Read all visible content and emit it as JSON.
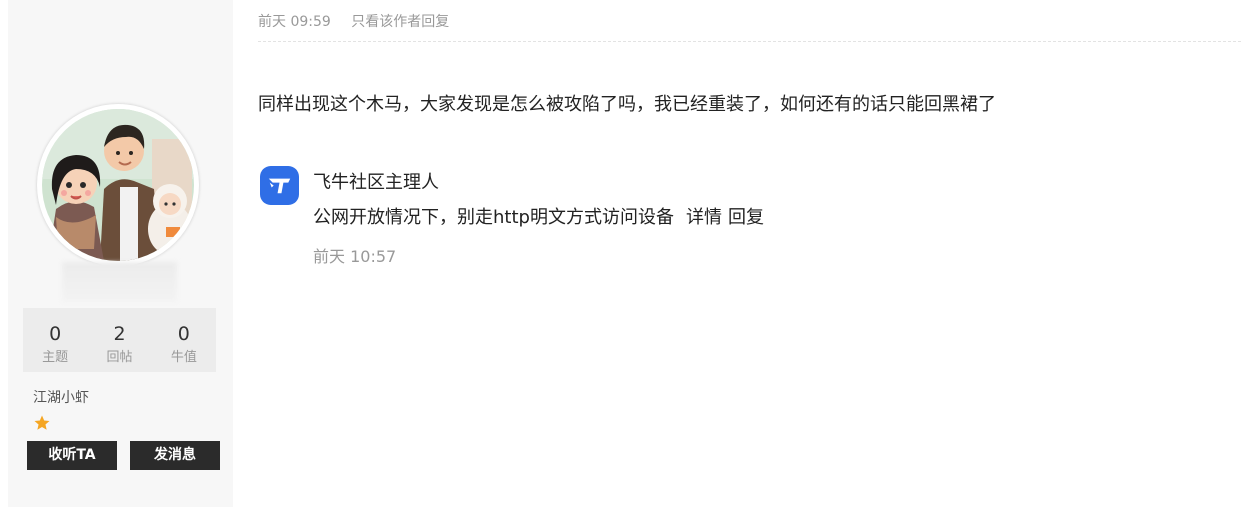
{
  "profile": {
    "avatar_icon": "family-illustration-avatar",
    "stats": [
      {
        "value": "0",
        "label": "主题"
      },
      {
        "value": "2",
        "label": "回帖"
      },
      {
        "value": "0",
        "label": "牛值"
      }
    ],
    "rank": "江湖小虾",
    "star_icon": "star-icon",
    "follow_label": "收听TA",
    "message_label": "发消息"
  },
  "post": {
    "time": "前天 09:59",
    "only_author_label": "只看该作者",
    "reply_label": "回复",
    "content": "同样出现这个木马，大家发现是怎么被攻陷了吗，我已经重装了，如何还有的话只能回黑裙了"
  },
  "reply": {
    "logo_icon": "feiniu-logo-icon",
    "author": "飞牛社区主理人",
    "content": "公网开放情况下，别走http明文方式访问设备",
    "detail_label": "详情",
    "reply_label": "回复",
    "time": "前天 10:57"
  },
  "colors": {
    "button_bg": "#2b2b2b",
    "star": "#f5a623",
    "logo": "#2f6ee6"
  }
}
